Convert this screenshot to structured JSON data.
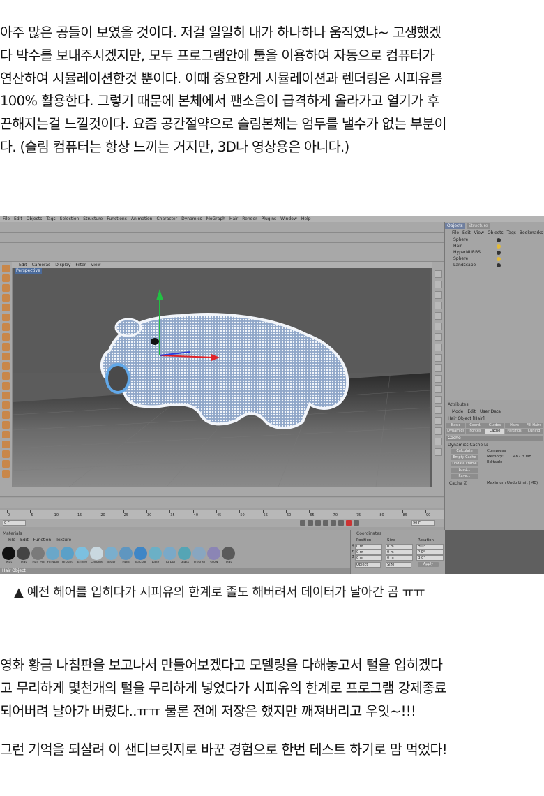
{
  "intro": {
    "lines": [
      "아주 많은 공들이 보였을 것이다. 저걸 일일히 내가 하나하나 움직였냐~ 고생했겠",
      "다 박수를 보내주시겠지만, 모두 프로그램안에 툴을 이용하여 자동으로 컴퓨터가",
      "연산하여 시뮬레이션한것 뿐이다. 이때 중요한게 시뮬레이션과 렌더링은 시피유를",
      "100% 활용한다. 그렇기 때문에 본체에서 팬소음이 급격하게 올라가고 열기가 후",
      "끈해지는걸 느낄것이다. 요즘 공간절약으로 슬림본체는 엄두를 낼수가 없는 부분이",
      "다. (슬림 컴퓨터는 항상 느끼는 거지만, 3D나 영상용은 아니다.)"
    ]
  },
  "screenshot": {
    "menu": [
      "File",
      "Edit",
      "Objects",
      "Tags",
      "Selection",
      "Structure",
      "Functions",
      "Animation",
      "Character",
      "Dynamics",
      "MoGraph",
      "Hair",
      "Render",
      "Plugins",
      "Window",
      "Help"
    ],
    "viewport_menu": [
      "Edit",
      "Cameras",
      "Display",
      "Filter",
      "View"
    ],
    "viewport_label": "Perspective",
    "objects_panel": {
      "tabs": [
        "Objects",
        "Structure"
      ],
      "menu": [
        "File",
        "Edit",
        "View",
        "Objects",
        "Tags",
        "Bookmarks"
      ],
      "items": [
        "Sphere",
        "Hair",
        "HyperNURBS",
        "Sphere",
        "Landscape"
      ]
    },
    "attributes_panel": {
      "title": "Attributes",
      "menu": [
        "Mode",
        "Edit",
        "User Data"
      ],
      "object": "Hair Object [Hair]",
      "tabs_row1": [
        "Basic",
        "Coord.",
        "Guides",
        "Hairs",
        "Fill Hairs"
      ],
      "tabs_row2": [
        "Dynamics",
        "Forces",
        "Cache",
        "Partings",
        "Curling"
      ],
      "section": "Cache",
      "dynamics_cache": "Dynamics Cache",
      "buttons": [
        "Calculate",
        "Empty Cache",
        "Update Frame",
        "Load...",
        "Save..."
      ],
      "fields": [
        {
          "label": "Compress",
          "value": ""
        },
        {
          "label": "Memory:",
          "value": "487.3 MB"
        },
        {
          "label": "Editable",
          "value": ""
        }
      ],
      "cache_label": "Cache",
      "max_undo": "Maximum Undo Limit (MB)"
    },
    "timeline": {
      "frame_start": "0 F",
      "frame_end": "90 F",
      "ticks": [
        "0",
        "5",
        "10",
        "15",
        "20",
        "25",
        "30",
        "35",
        "40",
        "45",
        "50",
        "55",
        "60",
        "65",
        "70",
        "75",
        "80",
        "85",
        "90"
      ]
    },
    "materials": {
      "title": "Materials",
      "menu": [
        "File",
        "Edit",
        "Function",
        "Texture"
      ],
      "items": [
        {
          "name": "Mat",
          "color": "#111111"
        },
        {
          "name": "Mat",
          "color": "#444444"
        },
        {
          "name": "Hair Ma",
          "color": "#7a7a7a"
        },
        {
          "name": "Fill Wall",
          "color": "#6aa7c9"
        },
        {
          "name": "Ground",
          "color": "#5aa0c8"
        },
        {
          "name": "Enviro",
          "color": "#7cc0e0"
        },
        {
          "name": "Chrome",
          "color": "#c9d8e0"
        },
        {
          "name": "Beach",
          "color": "#7aaecd"
        },
        {
          "name": "HDRI",
          "color": "#5f96c0"
        },
        {
          "name": "Backgr",
          "color": "#3f86c6"
        },
        {
          "name": "Lake",
          "color": "#6bb0c6"
        },
        {
          "name": "Turbul",
          "color": "#7aa9c8"
        },
        {
          "name": "Glass",
          "color": "#55a5b5"
        },
        {
          "name": "Fresnel",
          "color": "#88a6c0"
        },
        {
          "name": "Glow",
          "color": "#8b85b5"
        },
        {
          "name": "Mat",
          "color": "#5a5a5a"
        }
      ]
    },
    "coordinates": {
      "title": "Coordinates",
      "headers": [
        "Position",
        "Size",
        "Rotation"
      ],
      "rows": [
        {
          "axis": "X",
          "pos": "0 m",
          "size": "0 m",
          "rot": "H 0°"
        },
        {
          "axis": "Y",
          "pos": "0 m",
          "size": "0 m",
          "rot": "P 0°"
        },
        {
          "axis": "Z",
          "pos": "0 m",
          "size": "0 m",
          "rot": "B 0°"
        }
      ],
      "mode_left": "Object",
      "mode_mid": "Size",
      "apply": "Apply"
    },
    "status": "Hair Object"
  },
  "caption": "▲ 예전 헤어를 입히다가 시피유의 한계로 졸도 해버려서 데이터가 날아간 곰 ㅠㅠ",
  "body": {
    "lines": [
      "영화 황금 나침판을 보고나서 만들어보겠다고 모델링을 다해놓고서 털을 입히겠다",
      "고 무리하게 몇천개의 털을 무리하게 넣었다가 시피유의 한계로 프로그램 강제종료",
      "되어버려 날아가 버렸다..ㅠㅠ 물론 전에 저장은 했지만 깨져버리고 우잇~!!!"
    ]
  },
  "closing": "그런 기억을 되살려 이 샌디브릿지로 바꾼 경험으로 한번 테스트 하기로 맘 먹었다!"
}
